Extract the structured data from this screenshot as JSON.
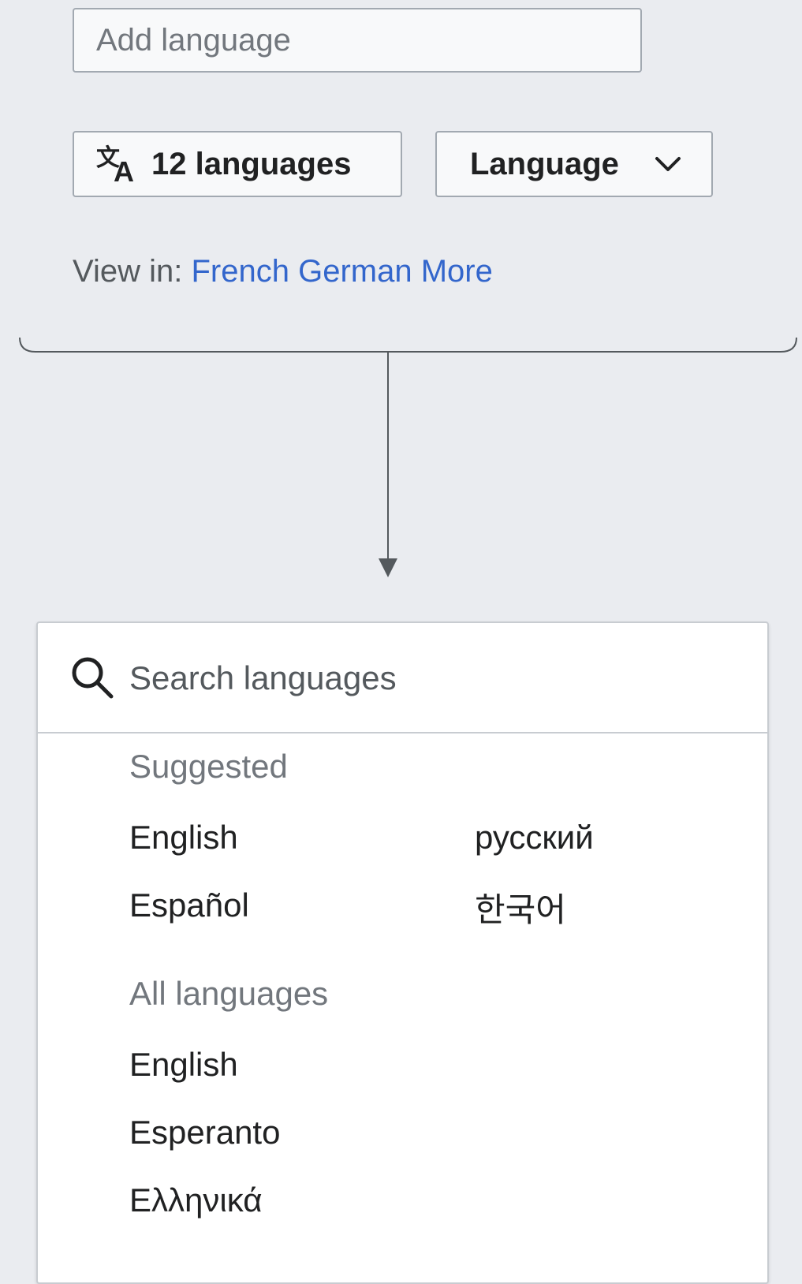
{
  "add_language": {
    "placeholder": "Add language"
  },
  "languages_button": {
    "label": "12 languages",
    "icon": "translate-icon"
  },
  "language_select": {
    "label": "Language",
    "icon": "chevron-down-icon"
  },
  "view_in": {
    "label": "View in:",
    "links": [
      "French",
      "German",
      "More"
    ]
  },
  "panel": {
    "search": {
      "placeholder": "Search languages",
      "icon": "search-icon"
    },
    "suggested": {
      "title": "Suggested",
      "col1": [
        "English",
        "Español"
      ],
      "col2": [
        "русский",
        "한국어"
      ]
    },
    "all_languages": {
      "title": "All languages",
      "items": [
        "English",
        "Esperanto",
        "Ελληνικά"
      ]
    }
  },
  "colors": {
    "background": "#eaecf0",
    "link": "#3366cc",
    "border": "#a2a9b1",
    "connector": "#54595d"
  }
}
